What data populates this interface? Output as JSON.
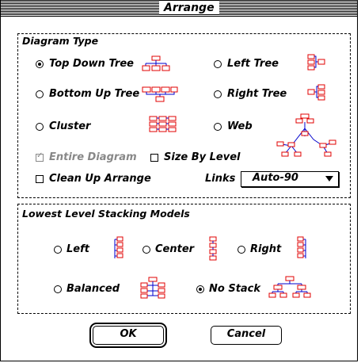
{
  "window": {
    "title": "Arrange"
  },
  "diagram_type": {
    "title": "Diagram Type",
    "options": [
      {
        "label": "Top Down Tree",
        "selected": true,
        "icon": "top-down-tree-icon"
      },
      {
        "label": "Left Tree",
        "selected": false,
        "icon": "left-tree-icon"
      },
      {
        "label": "Bottom Up Tree",
        "selected": false,
        "icon": "bottom-up-tree-icon"
      },
      {
        "label": "Right Tree",
        "selected": false,
        "icon": "right-tree-icon"
      },
      {
        "label": "Cluster",
        "selected": false,
        "icon": "cluster-icon"
      },
      {
        "label": "Web",
        "selected": false,
        "icon": "web-icon"
      }
    ],
    "entire_diagram": {
      "label": "Entire Diagram",
      "checked": true,
      "enabled": false
    },
    "size_by_level": {
      "label": "Size By Level",
      "checked": false
    },
    "clean_up_arrange": {
      "label": "Clean Up Arrange",
      "checked": false
    },
    "links": {
      "label": "Links",
      "value": "Auto-90"
    }
  },
  "stacking": {
    "title": "Lowest Level Stacking Models",
    "options": [
      {
        "label": "Left",
        "selected": false,
        "icon": "stack-left-icon"
      },
      {
        "label": "Center",
        "selected": false,
        "icon": "stack-center-icon"
      },
      {
        "label": "Right",
        "selected": false,
        "icon": "stack-right-icon"
      },
      {
        "label": "Balanced",
        "selected": false,
        "icon": "stack-balanced-icon"
      },
      {
        "label": "No Stack",
        "selected": true,
        "icon": "no-stack-icon"
      }
    ]
  },
  "buttons": {
    "ok": "OK",
    "cancel": "Cancel"
  },
  "colors": {
    "node_box": "#e00000",
    "link_line": "#0000cc"
  }
}
